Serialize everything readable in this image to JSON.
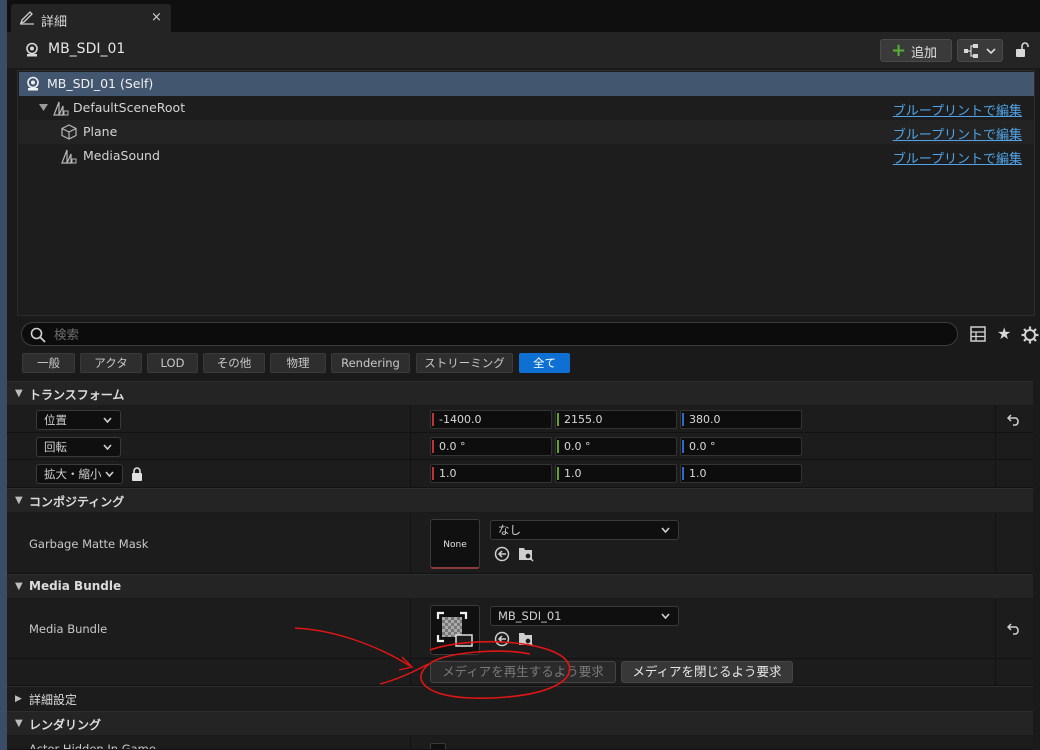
{
  "tab": {
    "title": "詳細",
    "close": "×",
    "icon": "pencil-icon"
  },
  "header": {
    "actor_name": "MB_SDI_01",
    "add_label": "追加",
    "icons": [
      "actor-icon",
      "blueprint-icon",
      "lock-icon"
    ]
  },
  "tree": {
    "items": [
      {
        "label": "MB_SDI_01 (Self)",
        "icon": "actor-icon",
        "selected": true
      },
      {
        "label": "DefaultSceneRoot",
        "icon": "scene-component-icon",
        "link": "ブループリントで編集"
      },
      {
        "label": "Plane",
        "icon": "static-mesh-icon",
        "link": "ブループリントで編集"
      },
      {
        "label": "MediaSound",
        "icon": "scene-component-icon",
        "link": "ブループリントで編集"
      }
    ]
  },
  "search": {
    "placeholder": "検索"
  },
  "filters": [
    "一般",
    "アクタ",
    "LOD",
    "その他",
    "物理",
    "Rendering",
    "ストリーミング",
    "全て"
  ],
  "active_filter": "全て",
  "sections": {
    "transform": {
      "title": "トランスフォーム",
      "location": {
        "label": "位置",
        "x": "-1400.0",
        "y": "2155.0",
        "z": "380.0"
      },
      "rotation": {
        "label": "回転",
        "x": "0.0 °",
        "y": "0.0 °",
        "z": "0.0 °"
      },
      "scale": {
        "label": "拡大・縮小",
        "x": "1.0",
        "y": "1.0",
        "z": "1.0"
      }
    },
    "compositing": {
      "title": "コンポジティング",
      "garbage_matte": {
        "label": "Garbage Matte Mask",
        "thumb_text": "None",
        "value": "なし"
      }
    },
    "media_bundle": {
      "title": "Media Bundle",
      "bundle": {
        "label": "Media Bundle",
        "value": "MB_SDI_01"
      },
      "play_button": "メディアを再生するよう要求",
      "close_button": "メディアを閉じるよう要求"
    },
    "advanced": {
      "title": "詳細設定"
    },
    "rendering": {
      "title": "レンダリング",
      "partial_label": "Actor Hidden In Game"
    }
  },
  "colors": {
    "accent": "#0e70d2",
    "link": "#4fa3e6",
    "selection": "#42576f",
    "annotation": "#e01515"
  }
}
